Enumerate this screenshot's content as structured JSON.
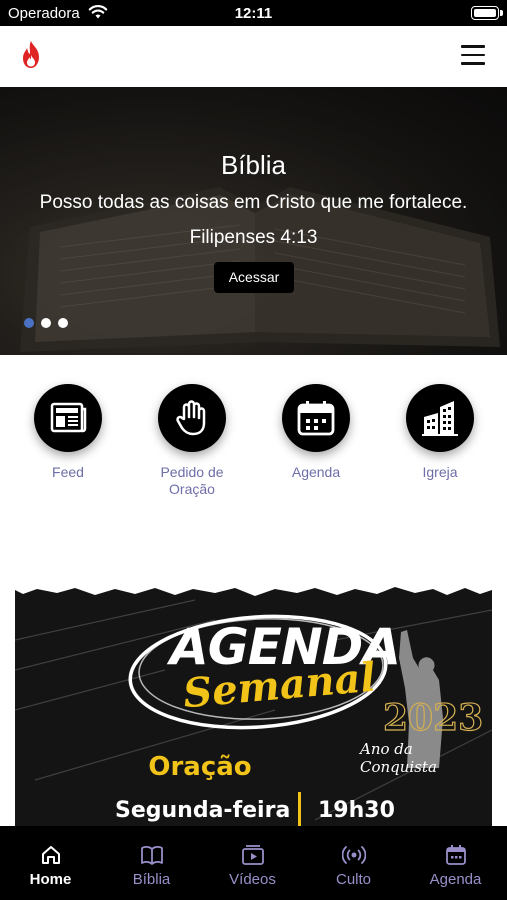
{
  "status_bar": {
    "carrier": "Operadora",
    "time": "12:11"
  },
  "header": {
    "logo_icon": "flame-icon",
    "menu_icon": "hamburger-menu-icon"
  },
  "hero": {
    "title": "Bíblia",
    "verse": "Posso todas as coisas em Cristo que me fortalece.",
    "reference": "Filipenses 4:13",
    "button_label": "Acessar",
    "slides_total": 3,
    "active_slide": 1,
    "active_dot_color": "#4a72c4"
  },
  "quick_actions": [
    {
      "label": "Feed",
      "icon": "newspaper-icon"
    },
    {
      "label": "Pedido de\nOração",
      "icon": "raised-hand-icon"
    },
    {
      "label": "Agenda",
      "icon": "calendar-icon"
    },
    {
      "label": "Igreja",
      "icon": "buildings-icon"
    }
  ],
  "banner": {
    "title": "AGENDA",
    "subtitle": "Semanal",
    "year": "2023",
    "year_caption": "Ano da Conquista",
    "event": "Oração",
    "day": "Segunda-feira",
    "time": "19h30",
    "accent_color": "#f2c318"
  },
  "tabbar": {
    "active_color": "#ffffff",
    "inactive_color": "#9a8fc9",
    "tabs": [
      {
        "label": "Home",
        "icon": "home-icon",
        "active": true
      },
      {
        "label": "Bíblia",
        "icon": "book-icon",
        "active": false
      },
      {
        "label": "Vídeos",
        "icon": "video-icon",
        "active": false
      },
      {
        "label": "Culto",
        "icon": "broadcast-icon",
        "active": false
      },
      {
        "label": "Agenda",
        "icon": "calendar-icon",
        "active": false
      }
    ]
  }
}
